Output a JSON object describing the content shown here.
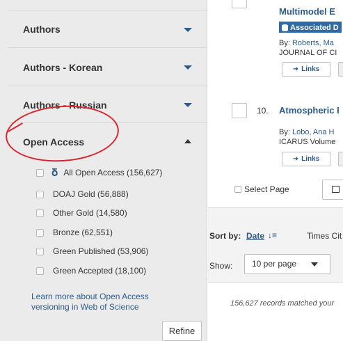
{
  "sidebar": {
    "facets": [
      {
        "label": "Authors"
      },
      {
        "label": "Authors - Korean"
      },
      {
        "label": "Authors - Russian"
      }
    ],
    "open_access": {
      "label": "Open Access",
      "items": [
        {
          "label": "All Open Access (156,627)"
        },
        {
          "label": "DOAJ Gold (56,888)"
        },
        {
          "label": "Other Gold (14,580)"
        },
        {
          "label": "Bronze (62,551)"
        },
        {
          "label": "Green Published (53,906)"
        },
        {
          "label": "Green Accepted (18,100)"
        }
      ],
      "learn_more": "Learn more about Open Access versioning in Web of Science",
      "refine_label": "Refine"
    }
  },
  "results": {
    "record9": {
      "title": "Multimodel E",
      "badge": "Associated D",
      "by_prefix": "By: ",
      "authors": "Roberts, Ma",
      "journal": "JOURNAL OF CI",
      "links_label": "Links"
    },
    "record10": {
      "number": "10.",
      "title": "Atmospheric I",
      "by_prefix": "By: ",
      "authors": "Lobo, Ana H",
      "journal": "ICARUS Volume",
      "links_label": "Links"
    },
    "select_page_label": "Select Page"
  },
  "toolbar": {
    "sort_label": "Sort by:",
    "sort_date": "Date",
    "sort_times": "Times Cit",
    "show_label": "Show:",
    "per_page": "10 per page"
  },
  "footer": {
    "records_text": "156,627 records matched your"
  },
  "colors": {
    "link": "#2d5c8a",
    "annotation": "#d9262f",
    "badge": "#2d6aa6"
  }
}
